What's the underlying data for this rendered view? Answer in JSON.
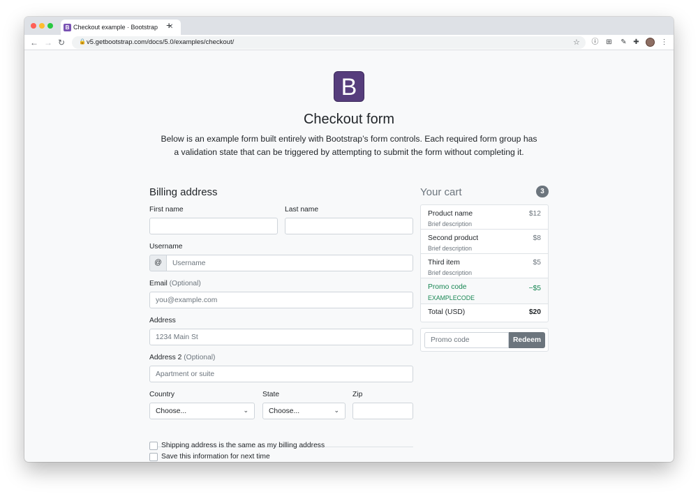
{
  "browser": {
    "tab_title": "Checkout example · Bootstrap",
    "tab_favicon_letter": "B",
    "tab_close": "✕",
    "new_tab": "+",
    "url": "v5.getbootstrap.com/docs/5.0/examples/checkout/",
    "back": "←",
    "forward": "→",
    "reload": "↻",
    "lock": "🔒",
    "star": "☆",
    "ext_info": "ⓘ",
    "ext_grid": "⊞",
    "ext_edit": "✎",
    "ext_puzzle": "✚",
    "menu": "⋮",
    "colors": {
      "close": "#ff5f57",
      "minimize": "#febc2e",
      "maximize": "#28c840"
    }
  },
  "header": {
    "logo_letter": "B",
    "logo_color": "#563d7c",
    "title": "Checkout form",
    "lead": "Below is an example form built entirely with Bootstrap’s form controls. Each required form group has a validation state that can be triggered by attempting to submit the form without completing it."
  },
  "billing": {
    "heading": "Billing address",
    "first_name_label": "First name",
    "last_name_label": "Last name",
    "username_label": "Username",
    "username_addon": "@",
    "username_placeholder": "Username",
    "email_label": "Email",
    "email_optional": "(Optional)",
    "email_placeholder": "you@example.com",
    "address_label": "Address",
    "address_placeholder": "1234 Main St",
    "address2_label": "Address 2",
    "address2_optional": "(Optional)",
    "address2_placeholder": "Apartment or suite",
    "country_label": "Country",
    "country_value": "Choose...",
    "state_label": "State",
    "state_value": "Choose...",
    "zip_label": "Zip",
    "same_address_label": "Shipping address is the same as my billing address",
    "save_info_label": "Save this information for next time"
  },
  "cart": {
    "heading": "Your cart",
    "count": "3",
    "items": [
      {
        "name": "Product name",
        "desc": "Brief description",
        "price": "$12"
      },
      {
        "name": "Second product",
        "desc": "Brief description",
        "price": "$8"
      },
      {
        "name": "Third item",
        "desc": "Brief description",
        "price": "$5"
      }
    ],
    "promo": {
      "name": "Promo code",
      "code": "EXAMPLECODE",
      "amount": "−$5",
      "color": "#198754"
    },
    "total_label": "Total (USD)",
    "total_value": "$20",
    "promo_placeholder": "Promo code",
    "redeem_label": "Redeem"
  }
}
